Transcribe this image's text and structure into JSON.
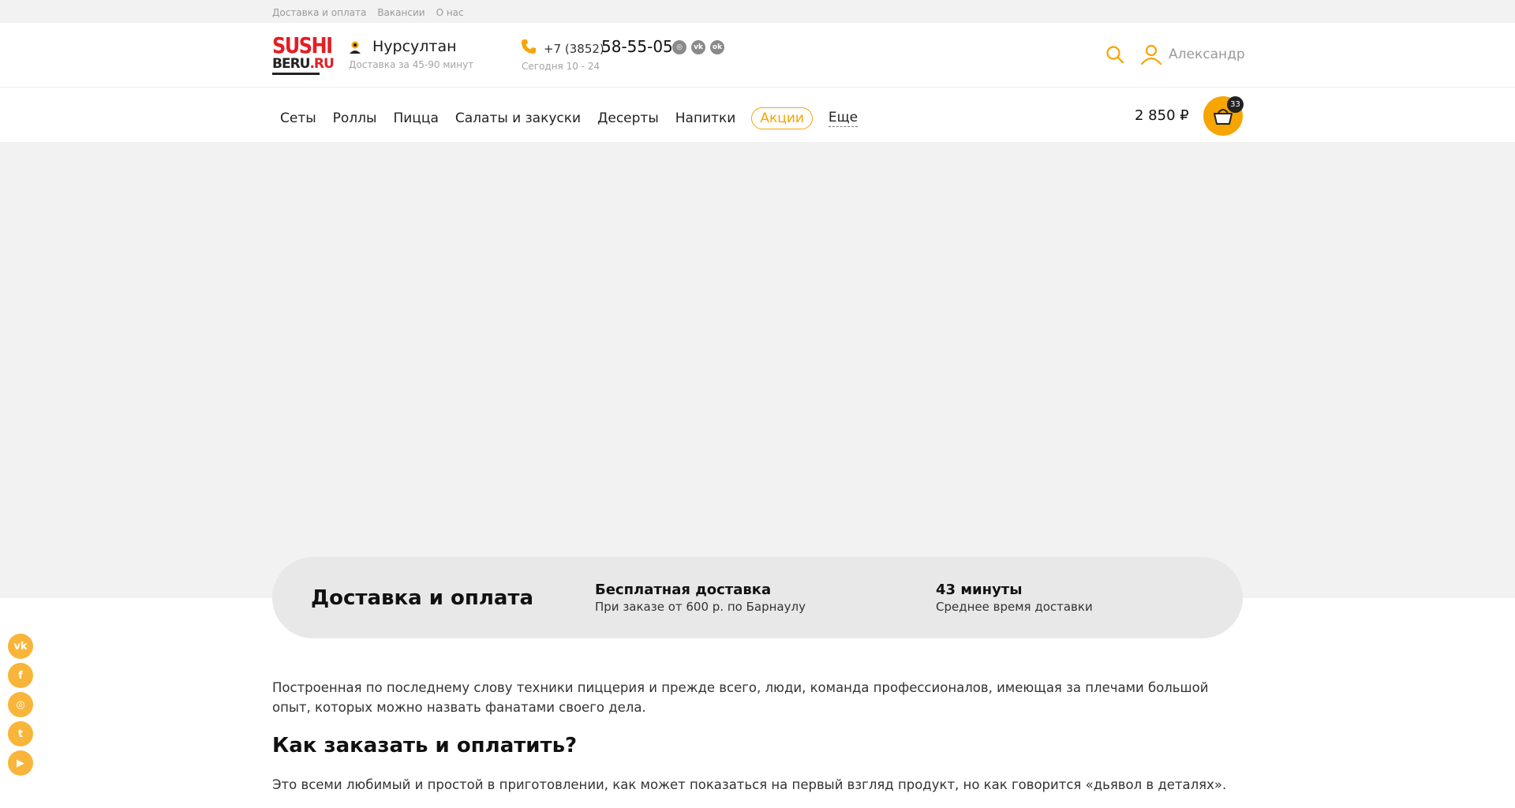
{
  "top_links": [
    "Доставка и оплата",
    "Вакансии",
    "О нас"
  ],
  "logo": {
    "line1": "SUSHI",
    "line2": "BERU",
    "line2_suffix": ".RU"
  },
  "city": {
    "name": "Нурсултан",
    "delivery_time": "Доставка за 45-90 минут"
  },
  "phone": {
    "code": "+7 (3852)",
    "number": "58-55-05",
    "hours": "Сегодня 10 - 24"
  },
  "header_socials": [
    {
      "icon": "instagram-icon",
      "glyph": "◎"
    },
    {
      "icon": "vk-icon",
      "glyph": "vk"
    },
    {
      "icon": "odnoklassniki-icon",
      "glyph": "ok"
    }
  ],
  "user": {
    "name": "Александр"
  },
  "menu": {
    "items": [
      "Сеты",
      "Роллы",
      "Пицца",
      "Салаты и закуски",
      "Десерты",
      "Напитки"
    ],
    "promo": "Акции",
    "more": "Еще"
  },
  "cart": {
    "sum": "2 850 ₽",
    "count": "33"
  },
  "infobar": {
    "title": "Доставка и оплата",
    "free_delivery_title": "Бесплатная доставка",
    "free_delivery_text": "При заказе от 600 р. по Барнаулу",
    "avg_time_title": "43 минуты",
    "avg_time_text": "Среднее время доставки"
  },
  "content": {
    "intro": "Построенная по последнему слову техники пиццерия и прежде всего, люди, команда профессионалов, имеющая за плечами большой опыт, которых можно назвать фанатами своего дела.",
    "heading": "Как заказать и оплатить?",
    "paragraph2": "Это всеми любимый и простой в приготовлении, как может показаться на первый взгляд продукт, но как говорится «дьявол в деталях»."
  },
  "side_socials": [
    {
      "icon": "vk-icon",
      "glyph": "vk"
    },
    {
      "icon": "facebook-icon",
      "glyph": "f"
    },
    {
      "icon": "instagram-icon",
      "glyph": "◎"
    },
    {
      "icon": "twitter-icon",
      "glyph": "t"
    },
    {
      "icon": "youtube-icon",
      "glyph": "▶"
    }
  ],
  "colors": {
    "accent": "#f7a501",
    "brand_red": "#e31e24",
    "banner_bg": "#f2f2f2"
  }
}
